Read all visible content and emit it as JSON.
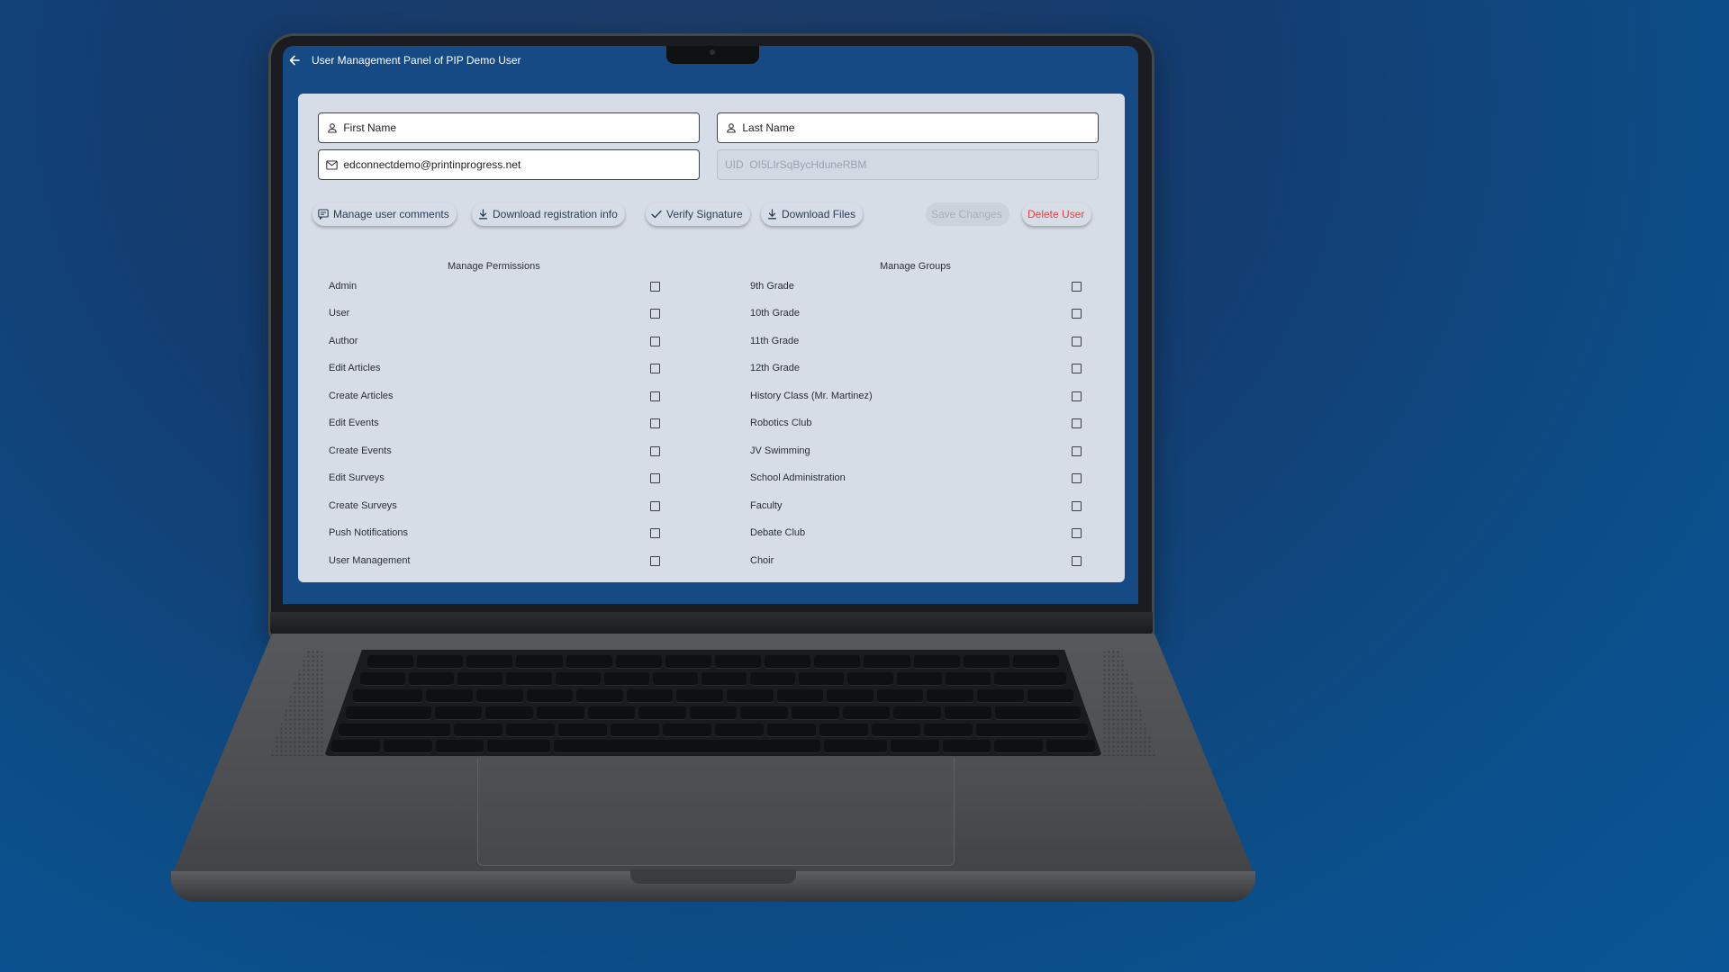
{
  "window": {
    "title": "User Management Panel of PIP Demo User"
  },
  "fields": {
    "first_name": {
      "value": "First Name"
    },
    "last_name": {
      "value": "Last Name"
    },
    "email": {
      "value": "edconnectdemo@printinprogress.net"
    },
    "uid": {
      "value": "UID  OI5LIrSqBycHduneRBM"
    }
  },
  "actions": {
    "manage_comments": "Manage user comments",
    "download_registration": "Download registration info",
    "verify_signature": "Verify Signature",
    "download_files": "Download Files",
    "save_changes": "Save Changes",
    "delete_user": "Delete User"
  },
  "permissions": {
    "title": "Manage Permissions",
    "items": [
      {
        "label": "Admin",
        "checked": false
      },
      {
        "label": "User",
        "checked": false
      },
      {
        "label": "Author",
        "checked": false
      },
      {
        "label": "Edit Articles",
        "checked": false
      },
      {
        "label": "Create Articles",
        "checked": false
      },
      {
        "label": "Edit Events",
        "checked": false
      },
      {
        "label": "Create Events",
        "checked": false
      },
      {
        "label": "Edit Surveys",
        "checked": false
      },
      {
        "label": "Create Surveys",
        "checked": false
      },
      {
        "label": "Push Notifications",
        "checked": false
      },
      {
        "label": "User Management",
        "checked": false
      }
    ]
  },
  "groups": {
    "title": "Manage Groups",
    "items": [
      {
        "label": "9th Grade",
        "checked": false
      },
      {
        "label": "10th Grade",
        "checked": false
      },
      {
        "label": "11th Grade",
        "checked": false
      },
      {
        "label": "12th Grade",
        "checked": false
      },
      {
        "label": "History Class (Mr. Martinez)",
        "checked": false
      },
      {
        "label": "Robotics Club",
        "checked": false
      },
      {
        "label": "JV Swimming",
        "checked": false
      },
      {
        "label": "School Administration",
        "checked": false
      },
      {
        "label": "Faculty",
        "checked": false
      },
      {
        "label": "Debate Club",
        "checked": false
      },
      {
        "label": "Choir",
        "checked": false
      }
    ]
  },
  "colors": {
    "accent": "#283d57",
    "danger": "#e14545",
    "screen_bg": "#154a85",
    "card_bg": "#d7dde7"
  },
  "icons": {
    "back": "arrow-left-icon",
    "person": "person-icon",
    "mail": "mail-icon",
    "comment": "comment-icon",
    "download": "download-icon",
    "check": "check-icon"
  }
}
